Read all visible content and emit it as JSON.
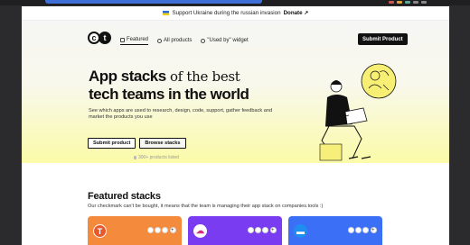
{
  "announcement": {
    "text": "Support Ukraine during the russian invasion",
    "link": "Donate ↗"
  },
  "nav": {
    "logo": [
      "c",
      "t"
    ],
    "links": [
      {
        "label": "Featured",
        "active": true
      },
      {
        "label": "All products",
        "active": false
      },
      {
        "label": "\"Used by\" widget",
        "active": false
      }
    ],
    "cta": "Submit Product"
  },
  "hero": {
    "title_strong_1": "App stacks",
    "title_accent": "of the best",
    "title_strong_2": "tech teams in the world",
    "description": "See which apps are used to research, design, code, support, gather feedback and market the products you use",
    "buttons": {
      "submit": "Submit product",
      "browse": "Browse stacks"
    },
    "count": "300+ products listed"
  },
  "featured": {
    "title": "Featured stacks",
    "subtitle": "Our checkmark can't be bought, it means that the team is managing their app stack on companies.tools :)",
    "cards": [
      {
        "color": "#f48a3b",
        "logo_char": "T"
      },
      {
        "color": "#7a3cf0",
        "logo_char": "☁"
      },
      {
        "color": "#3b6ff5",
        "logo_char": "▬"
      }
    ],
    "more": "+"
  },
  "colors": {
    "accent_yellow": "#fbfba8",
    "dark": "#111111"
  }
}
